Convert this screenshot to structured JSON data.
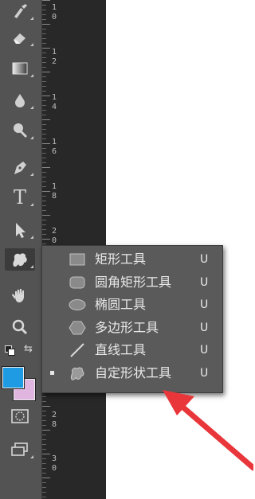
{
  "ruler": {
    "labels": [
      {
        "digits": [
          "1",
          "0"
        ]
      },
      {
        "digits": [
          "1",
          "2"
        ]
      },
      {
        "digits": [
          "1",
          "4"
        ]
      },
      {
        "digits": [
          "1",
          "6"
        ]
      },
      {
        "digits": [
          "1",
          "8"
        ]
      },
      {
        "digits": [
          "2",
          "0"
        ]
      },
      {
        "digits": [
          "2",
          "8"
        ]
      },
      {
        "digits": [
          "3",
          "0"
        ]
      }
    ]
  },
  "toolbar": {
    "tools": [
      {
        "name": "brush-tool",
        "icon": "brush-icon"
      },
      {
        "name": "eraser-tool",
        "icon": "eraser-icon"
      },
      {
        "name": "gradient-tool",
        "icon": "gradient-icon"
      },
      {
        "name": "blur-tool",
        "icon": "drop-icon"
      },
      {
        "name": "dodge-tool",
        "icon": "dodge-icon"
      },
      {
        "name": "pen-tool",
        "icon": "pen-icon"
      },
      {
        "name": "type-tool",
        "icon": "type-icon",
        "glyph": "T"
      },
      {
        "name": "path-selection-tool",
        "icon": "arrow-icon"
      },
      {
        "name": "custom-shape-tool",
        "icon": "custom-shape-icon",
        "active": true
      },
      {
        "name": "hand-tool",
        "icon": "hand-icon"
      },
      {
        "name": "zoom-tool",
        "icon": "zoom-icon"
      }
    ],
    "foreground_color": "#1e9be3",
    "background_color": "#e0b6e0"
  },
  "flyout": {
    "items": [
      {
        "label": "矩形工具",
        "shortcut": "U",
        "icon": "rectangle-icon",
        "selected": false
      },
      {
        "label": "圆角矩形工具",
        "shortcut": "U",
        "icon": "rounded-rectangle-icon",
        "selected": false
      },
      {
        "label": "椭圆工具",
        "shortcut": "U",
        "icon": "ellipse-icon",
        "selected": false
      },
      {
        "label": "多边形工具",
        "shortcut": "U",
        "icon": "polygon-icon",
        "selected": false
      },
      {
        "label": "直线工具",
        "shortcut": "U",
        "icon": "line-icon",
        "selected": false
      },
      {
        "label": "自定形状工具",
        "shortcut": "U",
        "icon": "custom-shape-icon",
        "selected": true
      }
    ]
  },
  "annotation": {
    "arrow_color": "#e8363b"
  }
}
